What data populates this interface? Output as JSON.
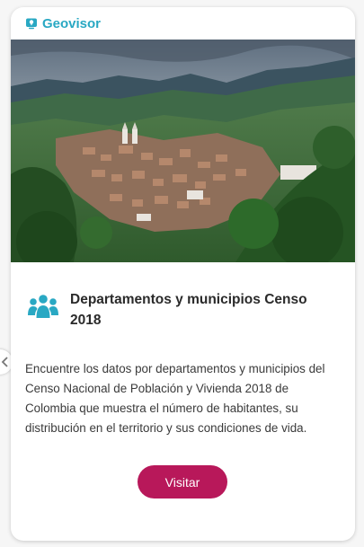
{
  "card": {
    "brand": "Geovisor",
    "image_alt": "Aerial view of a town in a green mountain valley",
    "title": "Departamentos y municipios Censo 2018",
    "description": "Encuentre los datos por departamentos y municipios del Censo Nacional de Población y Vivienda 2018 de Colombia que muestra el número de habitantes, su distribución en el territorio y sus condiciones de vida.",
    "button_label": "Visitar"
  },
  "colors": {
    "brand": "#29a8c3",
    "button": "#b8185a",
    "title": "#2a2a2a",
    "text": "#3a3a3a"
  },
  "icons": {
    "brand": "map-pin-icon",
    "title": "people-group-icon",
    "side": "chevron-left-icon"
  }
}
